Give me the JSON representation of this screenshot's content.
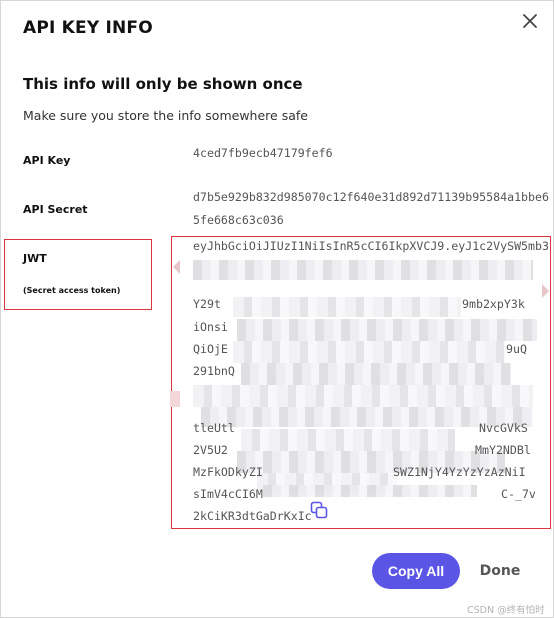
{
  "dialog": {
    "title": "API KEY INFO",
    "subtitle": "This info will only be shown once",
    "description": "Make sure you store the info somewhere safe"
  },
  "fields": {
    "api_key": {
      "label": "API Key",
      "value": "4ced7fb9ecb47179fef6"
    },
    "api_secret": {
      "label": "API Secret",
      "value_line1": "d7b5e929b832d985070c12f640e31d892d71139b95584a1bbe6",
      "value_line2": "5fe668c63c036"
    },
    "jwt": {
      "label": "JWT",
      "sublabel": "(Secret access token)",
      "lines": [
        "eyJhbGciOiJIUzI1NiIsInR5cCI6IkpXVCJ9.eyJ1c2VySW5mb3",
        "",
        "Y29t",
        "iOnsi",
        "QiOjE",
        "291bnQ",
        "",
        "",
        "tleUtl",
        "2V5U2",
        "MzFkODkyZI",
        "sImV4cCI6M",
        "2kCiKR3dtGaDrKxIc"
      ],
      "right_fragments": [
        "",
        "",
        "9mb2xpY3k",
        "",
        "9uQ",
        "",
        "",
        "",
        "NvcGVkS",
        "MmY2NDBl",
        "SWZ1NjY4YzYzYzAzNiI",
        "C-_7v",
        ""
      ]
    }
  },
  "buttons": {
    "copy_all": "Copy All",
    "done": "Done"
  },
  "icons": {
    "close": "close-icon",
    "copy": "copy-icon"
  },
  "watermark": "CSDN @终有怕时",
  "colors": {
    "accent": "#5b55e6",
    "highlight_box": "#d9363e"
  }
}
